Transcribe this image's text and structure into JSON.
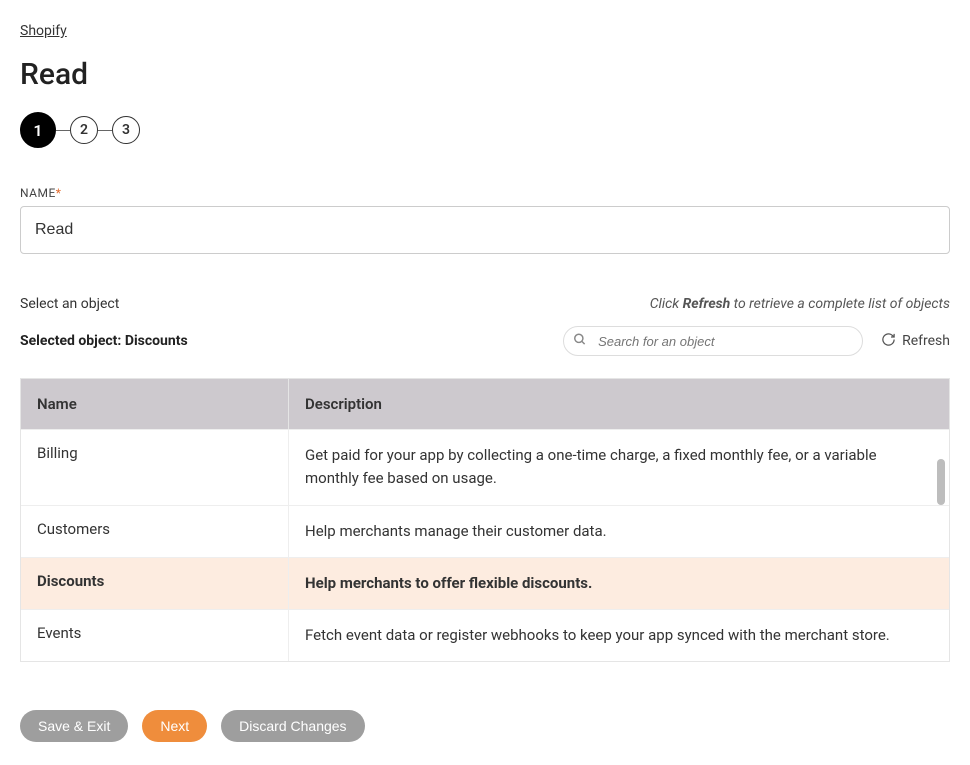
{
  "breadcrumb": "Shopify",
  "page_title": "Read",
  "stepper": {
    "steps": [
      "1",
      "2",
      "3"
    ],
    "active_index": 0
  },
  "name_field": {
    "label": "NAME",
    "required_mark": "*",
    "value": "Read"
  },
  "object_section": {
    "select_label": "Select an object",
    "hint_prefix": "Click ",
    "hint_bold": "Refresh",
    "hint_suffix": " to retrieve a complete list of objects",
    "selected_prefix": "Selected object: ",
    "selected_value": "Discounts",
    "search_placeholder": "Search for an object",
    "refresh_label": "Refresh"
  },
  "table": {
    "headers": {
      "name": "Name",
      "description": "Description"
    },
    "rows": [
      {
        "name": "Billing",
        "description": "Get paid for your app by collecting a one-time charge, a fixed monthly fee, or a variable monthly fee based on usage.",
        "selected": false
      },
      {
        "name": "Customers",
        "description": "Help merchants manage their customer data.",
        "selected": false
      },
      {
        "name": "Discounts",
        "description": "Help merchants to offer flexible discounts.",
        "selected": true
      },
      {
        "name": "Events",
        "description": "Fetch event data or register webhooks to keep your app synced with the merchant store.",
        "selected": false
      }
    ]
  },
  "buttons": {
    "save_exit": "Save & Exit",
    "next": "Next",
    "discard": "Discard Changes"
  }
}
